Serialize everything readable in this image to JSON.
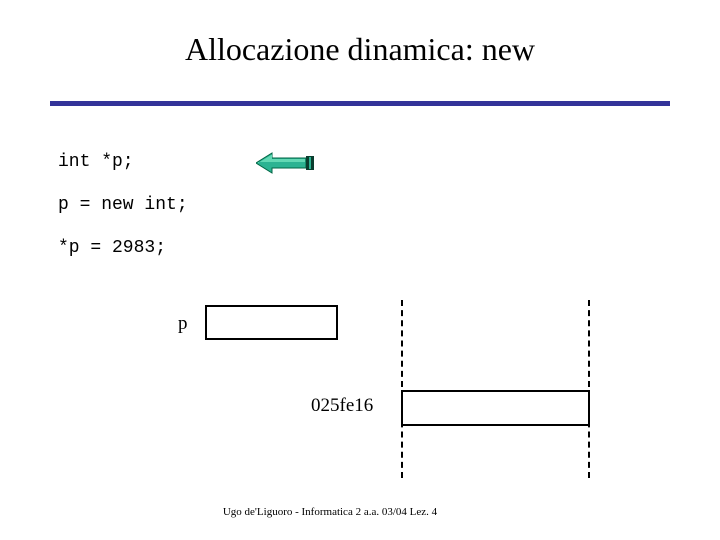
{
  "slide": {
    "title": "Allocazione dinamica: new",
    "rule_color": "#333399",
    "background_color": "#ffffff"
  },
  "code": {
    "lines": [
      "int *p;",
      "p = new int;",
      "*p = 2983;"
    ]
  },
  "annotation": {
    "arrow_icon": "arrow-left-icon",
    "arrow_body_color": "#2cb392",
    "arrow_highlight_color": "#63d8b4",
    "arrow_outline_color": "#006644",
    "arrow_cap_color": "#0a3d2e"
  },
  "diagram": {
    "pointer_label": "p",
    "address_label": "025fe16",
    "pointer_box_value": "",
    "heap_box_value": "",
    "rail_style": "dashed"
  },
  "footer": {
    "text": "Ugo de'Liguoro - Informatica 2 a.a. 03/04 Lez. 4"
  }
}
